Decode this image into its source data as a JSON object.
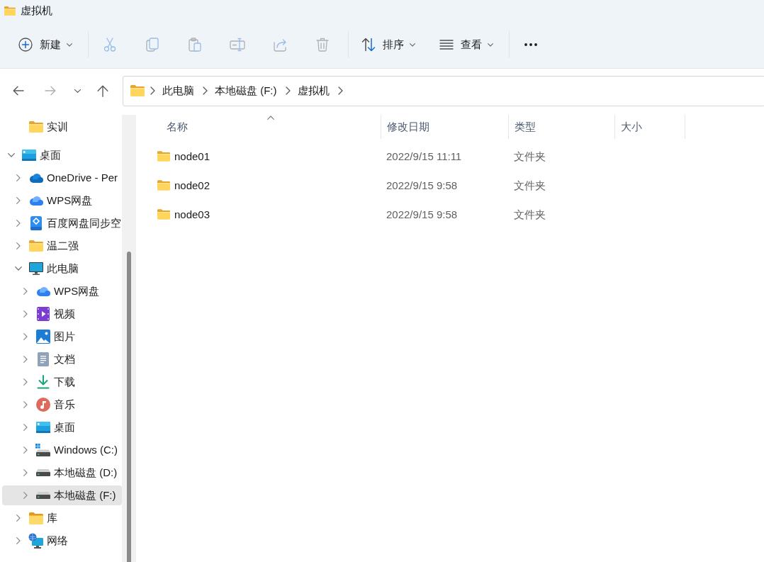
{
  "window": {
    "title": "虚拟机"
  },
  "toolbar": [
    {
      "kind": "new",
      "label": "新建",
      "dropdown": true,
      "disabled": false
    },
    {
      "kind": "divider"
    },
    {
      "kind": "cut",
      "disabled": true
    },
    {
      "kind": "copy",
      "disabled": true
    },
    {
      "kind": "paste",
      "disabled": true
    },
    {
      "kind": "rename",
      "disabled": true
    },
    {
      "kind": "share",
      "disabled": true
    },
    {
      "kind": "delete",
      "disabled": true
    },
    {
      "kind": "divider"
    },
    {
      "kind": "sort",
      "label": "排序",
      "dropdown": true,
      "disabled": false
    },
    {
      "kind": "view",
      "label": "查看",
      "dropdown": true,
      "disabled": false
    },
    {
      "kind": "divider"
    },
    {
      "kind": "more",
      "disabled": false
    }
  ],
  "navigation": [
    {
      "kind": "back",
      "disabled": false
    },
    {
      "kind": "forward",
      "disabled": true
    },
    {
      "kind": "recent",
      "disabled": false
    },
    {
      "kind": "up",
      "disabled": false
    }
  ],
  "address_bar": {
    "segments": [
      "此电脑",
      "本地磁盘 (F:)",
      "虚拟机"
    ]
  },
  "sidebar": {
    "pinned": [
      {
        "label": "实训",
        "kind": "folder",
        "selected": false
      }
    ],
    "tree": [
      {
        "label": "桌面",
        "kind": "desktop",
        "expanded": true,
        "selected": false,
        "children": [
          {
            "label": "OneDrive - Per",
            "kind": "onedrive",
            "expanded": false,
            "selected": false
          },
          {
            "label": "WPS网盘",
            "kind": "cloud",
            "expanded": false,
            "selected": false
          },
          {
            "label": "百度网盘同步空",
            "kind": "sync",
            "expanded": false,
            "selected": false
          },
          {
            "label": "温二强",
            "kind": "folder",
            "expanded": false,
            "selected": false
          },
          {
            "label": "此电脑",
            "kind": "pc",
            "expanded": true,
            "selected": false,
            "children": [
              {
                "label": "WPS网盘",
                "kind": "cloud",
                "expanded": false,
                "selected": false
              },
              {
                "label": "视频",
                "kind": "videos",
                "expanded": false,
                "selected": false
              },
              {
                "label": "图片",
                "kind": "pictures",
                "expanded": false,
                "selected": false
              },
              {
                "label": "文档",
                "kind": "documents",
                "expanded": false,
                "selected": false
              },
              {
                "label": "下载",
                "kind": "downloads",
                "expanded": false,
                "selected": false
              },
              {
                "label": "音乐",
                "kind": "music",
                "expanded": false,
                "selected": false
              },
              {
                "label": "桌面",
                "kind": "desktop",
                "expanded": false,
                "selected": false
              },
              {
                "label": "Windows (C:)",
                "kind": "system-drive",
                "expanded": false,
                "selected": false
              },
              {
                "label": "本地磁盘 (D:)",
                "kind": "drive",
                "expanded": false,
                "selected": false
              },
              {
                "label": "本地磁盘 (F:)",
                "kind": "drive",
                "expanded": false,
                "selected": true
              }
            ]
          },
          {
            "label": "库",
            "kind": "library",
            "expanded": false,
            "selected": false
          },
          {
            "label": "网络",
            "kind": "network",
            "expanded": false,
            "selected": false
          }
        ]
      }
    ]
  },
  "file_list": {
    "columns": [
      {
        "label": "名称",
        "sorted": true
      },
      {
        "label": "修改日期",
        "sorted": false
      },
      {
        "label": "类型",
        "sorted": false
      },
      {
        "label": "大小",
        "sorted": false
      }
    ],
    "rows": [
      {
        "name": "node01",
        "modified": "2022/9/15 11:11",
        "type": "文件夹",
        "selected": false
      },
      {
        "name": "node02",
        "modified": "2022/9/15 9:58",
        "type": "文件夹",
        "selected": false
      },
      {
        "name": "node03",
        "modified": "2022/9/15 9:58",
        "type": "文件夹",
        "selected": false
      }
    ]
  }
}
